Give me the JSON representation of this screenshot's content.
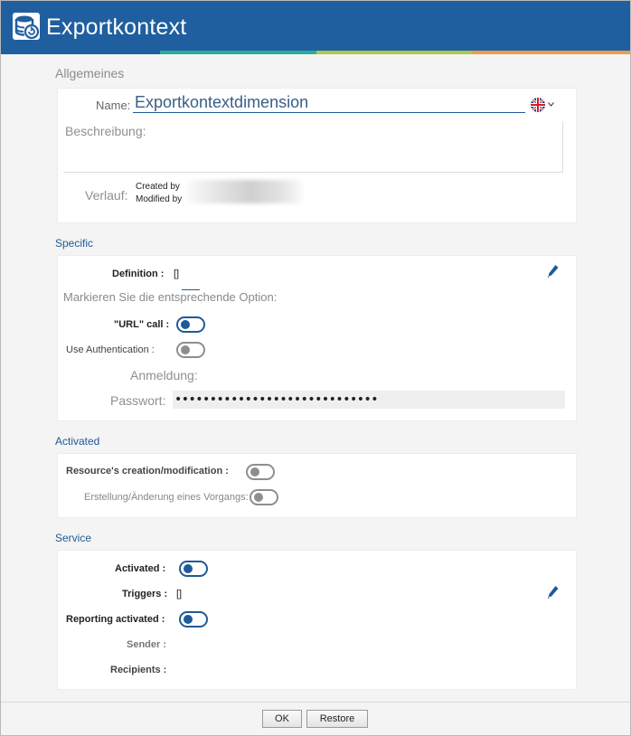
{
  "window": {
    "title": "Exportkontext"
  },
  "sections": {
    "general": "Allgemeines",
    "specific": "Specific",
    "activated": "Activated",
    "service": "Service"
  },
  "general": {
    "name_label": "Name:",
    "name_value": "Exportkontextdimension",
    "language_icon": "uk-flag-icon",
    "description_placeholder": "Beschreibung:",
    "history_label": "Verlauf:",
    "created_by": "Created by",
    "modified_by": "Modified by"
  },
  "specific": {
    "definition_label": "Definition :",
    "definition_value": "[]",
    "option_hint": "Markieren Sie die entsprechende Option:",
    "url_call_label": "\"URL\" call :",
    "url_call_on": true,
    "use_auth_label": "Use Authentication :",
    "use_auth_on": false,
    "login_label": "Anmeldung:",
    "password_label": "Passwort:",
    "password_value": "•••••••••••••••••••••••••••••"
  },
  "activated": {
    "resource_label": "Resource's creation/modification :",
    "resource_on": false,
    "process_label": "Erstellung/Änderung eines Vorgangs:",
    "process_on": false
  },
  "service": {
    "activated_label": "Activated :",
    "activated_on": true,
    "triggers_label": "Triggers :",
    "triggers_value": "[]",
    "reporting_label": "Reporting activated :",
    "reporting_on": true,
    "sender_label": "Sender :",
    "recipients_label": "Recipients :"
  },
  "footer": {
    "ok_label": "OK",
    "restore_label": "Restore"
  },
  "colors": {
    "brand": "#1f5f9f",
    "accent_teal": "#2aae9c",
    "accent_green": "#a8c94a",
    "accent_orange": "#ee9a47"
  }
}
